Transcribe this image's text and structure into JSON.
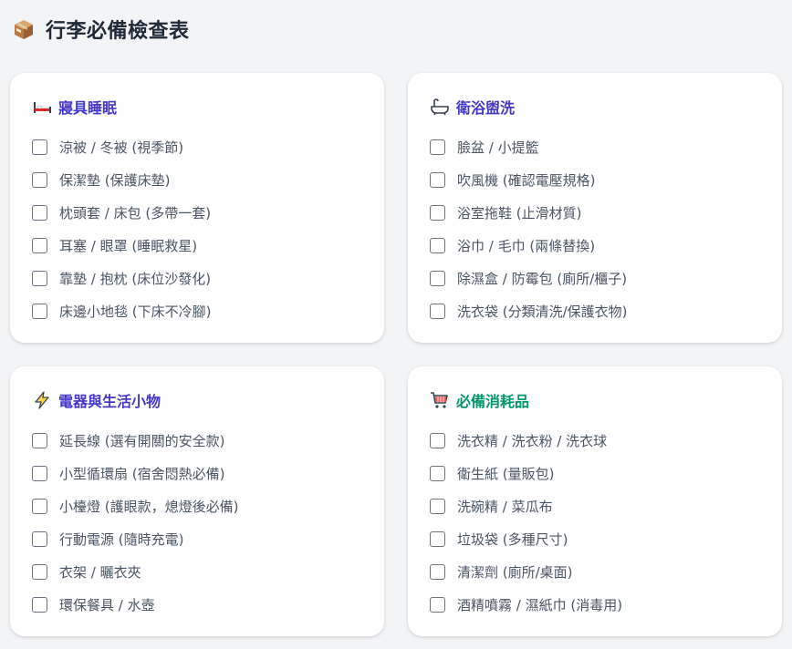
{
  "header": {
    "icon": "package-box-icon",
    "title": "行李必備檢查表"
  },
  "sections": [
    {
      "icon": "bed-icon",
      "title": "寢具睡眠",
      "title_color": "#4338ca",
      "items": [
        "涼被 / 冬被 (視季節)",
        "保潔墊 (保護床墊)",
        "枕頭套 / 床包 (多帶一套)",
        "耳塞 / 眼罩 (睡眠救星)",
        "靠墊 / 抱枕 (床位沙發化)",
        "床邊小地毯 (下床不冷腳)"
      ]
    },
    {
      "icon": "bathtub-icon",
      "title": "衛浴盥洗",
      "title_color": "#4338ca",
      "items": [
        "臉盆 / 小提籃",
        "吹風機 (確認電壓規格)",
        "浴室拖鞋 (止滑材質)",
        "浴巾 / 毛巾 (兩條替換)",
        "除濕盒 / 防霉包 (廁所/櫃子)",
        "洗衣袋 (分類清洗/保護衣物)"
      ]
    },
    {
      "icon": "lightning-icon",
      "title": "電器與生活小物",
      "title_color": "#4338ca",
      "items": [
        "延長線 (選有開關的安全款)",
        "小型循環扇 (宿舍悶熱必備)",
        "小檯燈 (護眼款，熄燈後必備)",
        "行動電源 (隨時充電)",
        "衣架 / 曬衣夾",
        "環保餐具 / 水壺"
      ]
    },
    {
      "icon": "shopping-cart-icon",
      "title": "必備消耗品",
      "title_color": "#059669",
      "items": [
        "洗衣精 / 洗衣粉 / 洗衣球",
        "衛生紙 (量販包)",
        "洗碗精 / 菜瓜布",
        "垃圾袋 (多種尺寸)",
        "清潔劑 (廁所/桌面)",
        "酒精噴霧 / 濕紙巾 (消毒用)"
      ]
    }
  ]
}
